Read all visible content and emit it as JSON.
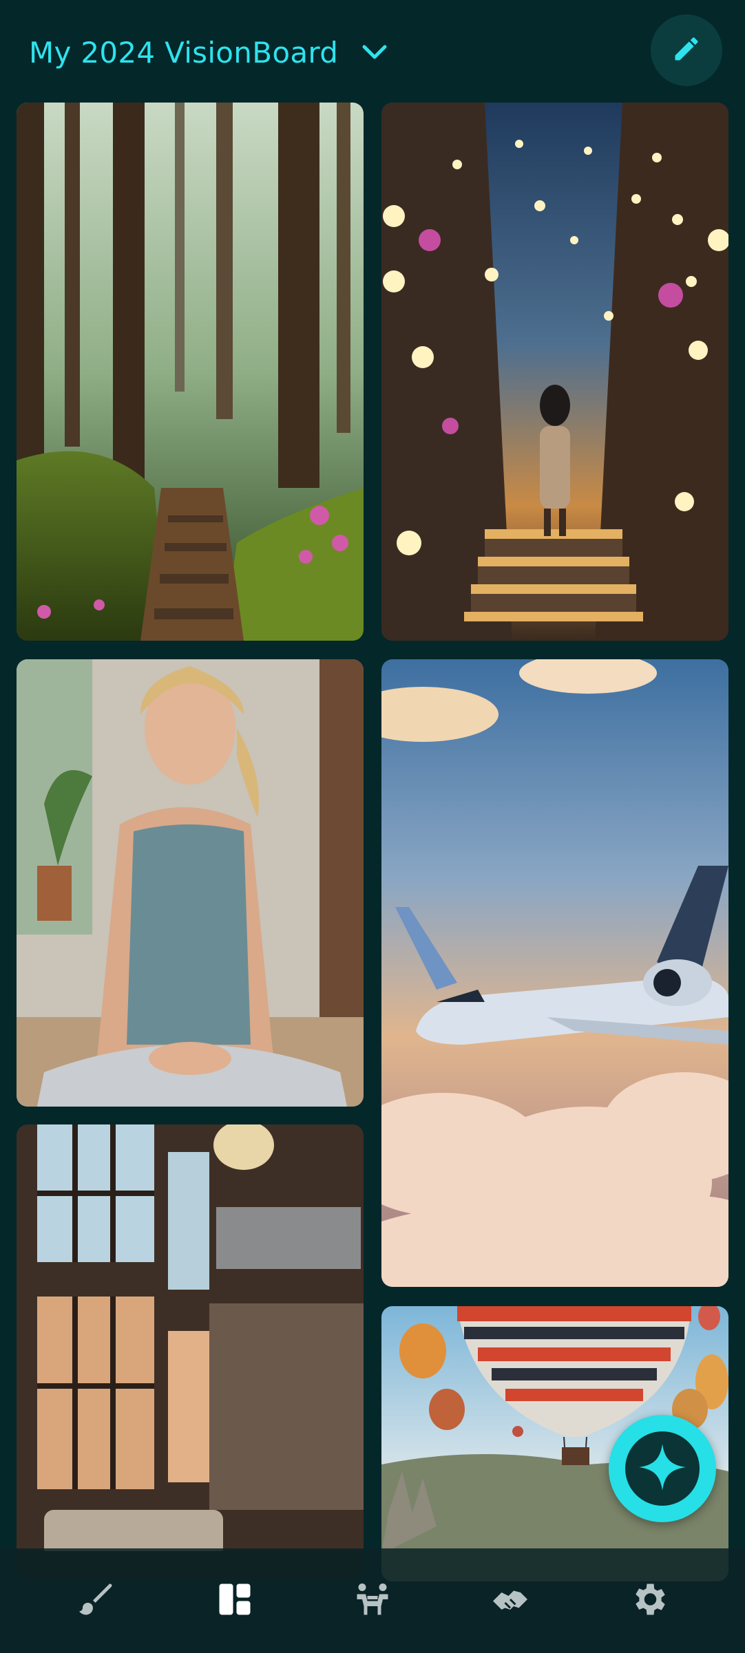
{
  "header": {
    "title": "My 2024 VisionBoard",
    "dropdown_icon": "chevron-down-icon",
    "edit_icon": "pencil-icon"
  },
  "board": {
    "tiles": [
      {
        "subject": "forest-path-stairs"
      },
      {
        "subject": "lantern-stair-alley"
      },
      {
        "subject": "woman-meditating"
      },
      {
        "subject": "private-jet-clouds"
      },
      {
        "subject": "luxury-loft-interior"
      },
      {
        "subject": "hot-air-balloons"
      }
    ]
  },
  "fab": {
    "icon": "sparkle-icon"
  },
  "bottom_nav": {
    "items": [
      {
        "icon": "brush-icon",
        "active": false
      },
      {
        "icon": "dashboard-icon",
        "active": true
      },
      {
        "icon": "community-icon",
        "active": false
      },
      {
        "icon": "handshake-icon",
        "active": false
      },
      {
        "icon": "gear-icon",
        "active": false
      }
    ]
  },
  "colors": {
    "background": "#04272a",
    "accent": "#2ee3ee",
    "nav_icon": "#b7c2c4",
    "nav_icon_active": "#ffffff"
  }
}
